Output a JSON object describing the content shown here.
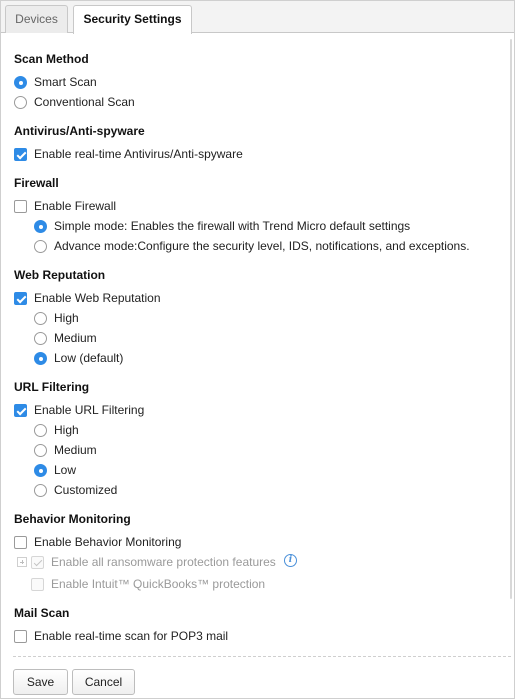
{
  "tabs": [
    {
      "label": "Devices",
      "active": false
    },
    {
      "label": "Security Settings",
      "active": true
    }
  ],
  "scan_method": {
    "heading": "Scan Method",
    "options": [
      {
        "label": "Smart Scan",
        "selected": true
      },
      {
        "label": "Conventional Scan",
        "selected": false
      }
    ]
  },
  "antivirus": {
    "heading": "Antivirus/Anti-spyware",
    "enable_label": "Enable real-time Antivirus/Anti-spyware",
    "enabled": true
  },
  "firewall": {
    "heading": "Firewall",
    "enable_label": "Enable Firewall",
    "enabled": false,
    "modes": [
      {
        "label": "Simple mode: Enables the firewall with Trend Micro default settings",
        "selected": true
      },
      {
        "label": "Advance mode:Configure the security level, IDS, notifications, and exceptions.",
        "selected": false
      }
    ]
  },
  "web_reputation": {
    "heading": "Web Reputation",
    "enable_label": "Enable Web Reputation",
    "enabled": true,
    "levels": [
      {
        "label": "High",
        "selected": false
      },
      {
        "label": "Medium",
        "selected": false
      },
      {
        "label": "Low (default)",
        "selected": true
      }
    ]
  },
  "url_filtering": {
    "heading": "URL Filtering",
    "enable_label": "Enable URL Filtering",
    "enabled": true,
    "levels": [
      {
        "label": "High",
        "selected": false
      },
      {
        "label": "Medium",
        "selected": false
      },
      {
        "label": "Low",
        "selected": true
      },
      {
        "label": "Customized",
        "selected": false
      }
    ]
  },
  "behavior_monitoring": {
    "heading": "Behavior Monitoring",
    "enable_label": "Enable Behavior Monitoring",
    "enabled": false,
    "ransomware_label": "Enable all ransomware protection features",
    "ransomware_checked": true,
    "quickbooks_label": "Enable Intuit™ QuickBooks™ protection",
    "quickbooks_checked": false
  },
  "mail_scan": {
    "heading": "Mail Scan",
    "enable_label": "Enable real-time scan for POP3 mail",
    "enabled": false
  },
  "footer": {
    "save_label": "Save",
    "cancel_label": "Cancel"
  },
  "colors": {
    "accent": "#2e8be6",
    "info": "#4a90d9"
  }
}
